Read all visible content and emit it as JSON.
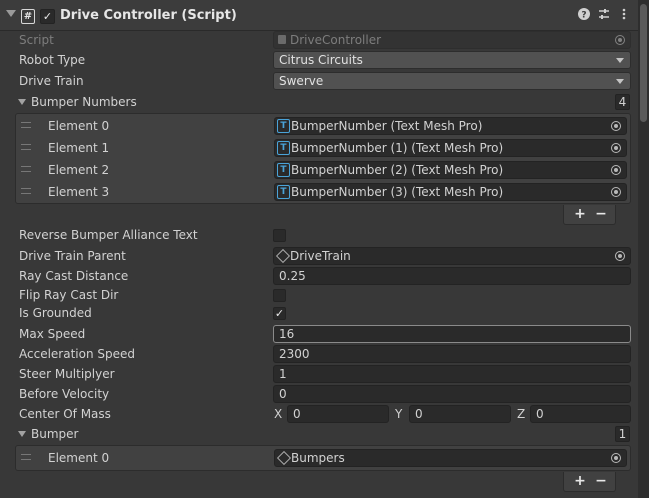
{
  "header": {
    "title": "Drive Controller (Script)",
    "enabled": true,
    "icons": [
      "help-icon",
      "preset-icon",
      "more-menu-icon"
    ]
  },
  "script": {
    "label": "Script",
    "value": "DriveController"
  },
  "robot_type": {
    "label": "Robot Type",
    "value": "Citrus Circuits"
  },
  "drive_train": {
    "label": "Drive Train",
    "value": "Swerve"
  },
  "bumper_numbers": {
    "label": "Bumper Numbers",
    "count": "4",
    "items": [
      {
        "label": "Element 0",
        "value": "BumperNumber (Text Mesh Pro)"
      },
      {
        "label": "Element 1",
        "value": "BumperNumber (1) (Text Mesh Pro)"
      },
      {
        "label": "Element 2",
        "value": "BumperNumber (2) (Text Mesh Pro)"
      },
      {
        "label": "Element 3",
        "value": "BumperNumber (3) (Text Mesh Pro)"
      }
    ]
  },
  "list_buttons": {
    "add": "+",
    "remove": "−"
  },
  "reverse_bumper_alliance_text": {
    "label": "Reverse Bumper Alliance Text",
    "checked": false
  },
  "drive_train_parent": {
    "label": "Drive Train Parent",
    "value": "DriveTrain"
  },
  "ray_cast_distance": {
    "label": "Ray Cast Distance",
    "value": "0.25"
  },
  "flip_ray_cast_dir": {
    "label": "Flip Ray Cast Dir",
    "checked": false
  },
  "is_grounded": {
    "label": "Is Grounded",
    "checked": true,
    "mark": "✓"
  },
  "max_speed": {
    "label": "Max Speed",
    "value": "16"
  },
  "acceleration_speed": {
    "label": "Acceleration Speed",
    "value": "2300"
  },
  "steer_multiplyer": {
    "label": "Steer Multiplyer",
    "value": "1"
  },
  "before_velocity": {
    "label": "Before Velocity",
    "value": "0"
  },
  "center_of_mass": {
    "label": "Center Of Mass",
    "x_label": "X",
    "x": "0",
    "y_label": "Y",
    "y": "0",
    "z_label": "Z",
    "z": "0"
  },
  "bumper": {
    "label": "Bumper",
    "count": "1",
    "items": [
      {
        "label": "Element 0",
        "value": "Bumpers"
      }
    ]
  },
  "colors": {
    "background": "#383838",
    "field": "#2a2a2a",
    "accent_tmp": "#4aa3d8"
  }
}
